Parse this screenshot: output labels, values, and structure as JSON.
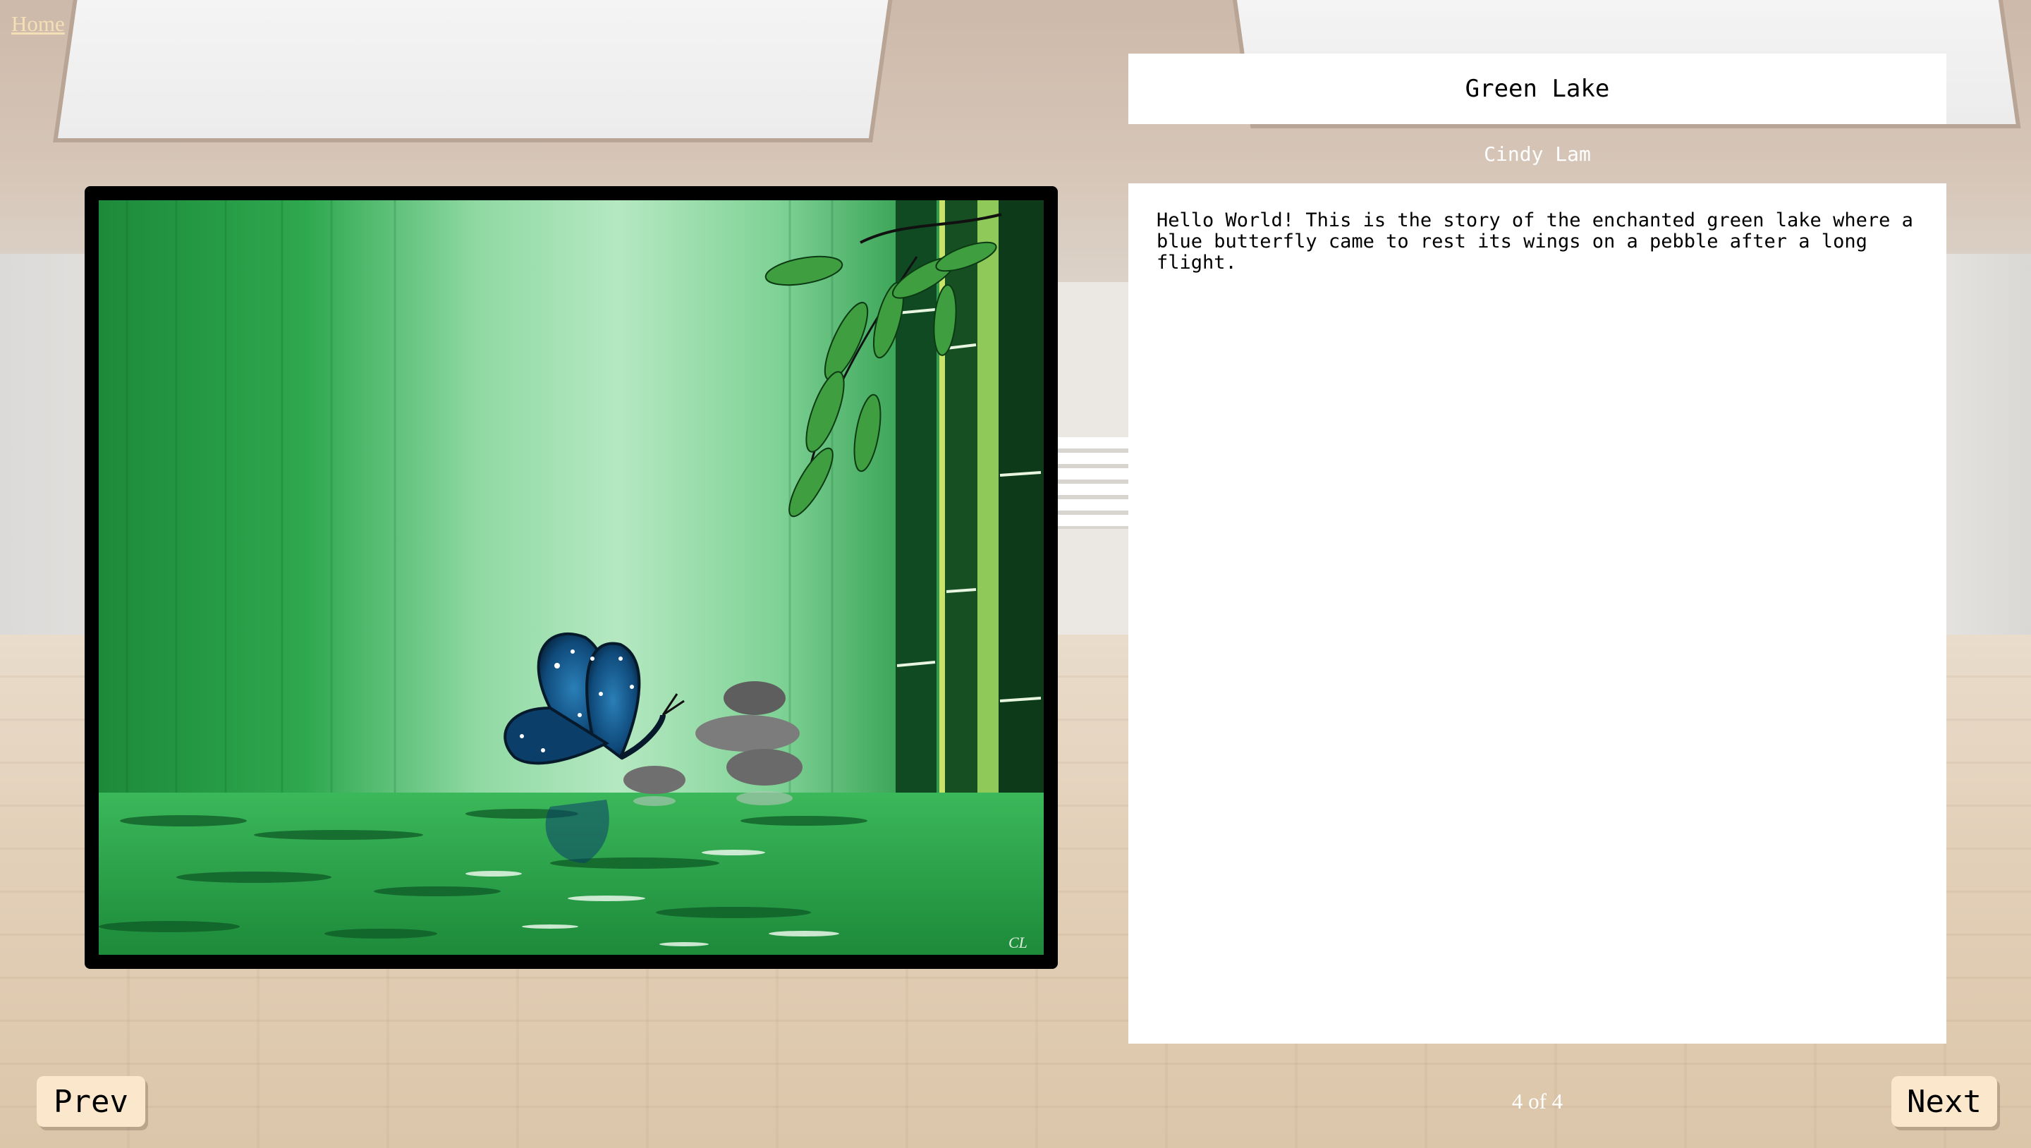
{
  "nav": {
    "home_label": "Home"
  },
  "artwork": {
    "title": "Green Lake",
    "artist": "Cindy Lam",
    "story": "Hello World! This is the story of the enchanted green lake where a\nblue butterfly came to rest its wings on a pebble after a long\nflight.",
    "signature": "CL"
  },
  "pagination": {
    "prev_label": "Prev",
    "next_label": "Next",
    "counter": "4 of 4"
  },
  "colors": {
    "button_bg": "#fbe7cc",
    "home_link": "#f4dfb6",
    "panel_bg": "#ffffff"
  }
}
